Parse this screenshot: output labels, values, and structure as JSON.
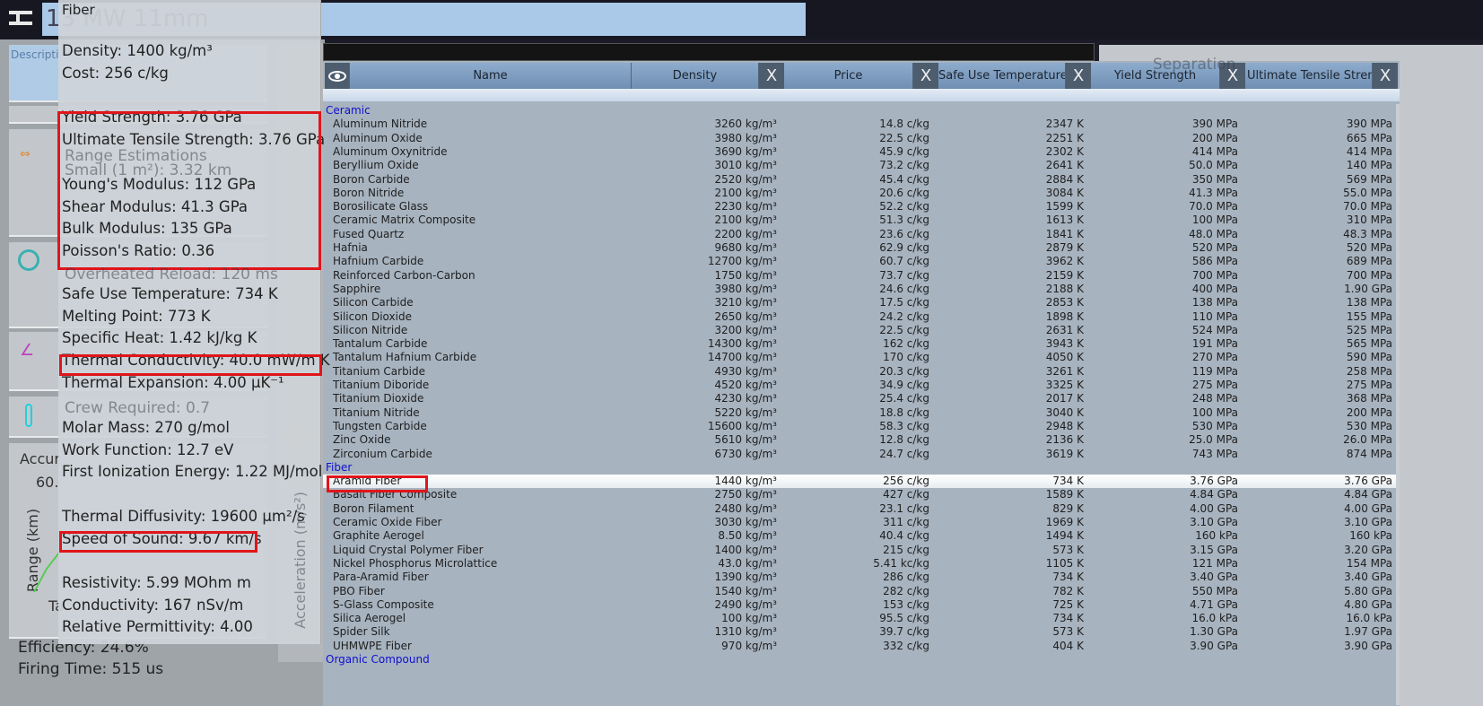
{
  "header": {
    "title": "13 MW 11mm"
  },
  "background": {
    "description_label": "Descripti",
    "range_estimations": "Range Estimations",
    "small_range": "Small (1 m²): 3.32 km",
    "overheated_reload": "Overheated Reload: 120 ms",
    "crew_required": "Crew Required: 0.7",
    "accuracy": "Accur",
    "range_axis": "Range (km)",
    "range_tick": "60.",
    "target_label": "Ta",
    "efficiency": "Efficiency: 24.6%",
    "firing_time": "Firing Time: 515 us",
    "separation": "Separation",
    "acceleration_axis": "Acceleration (m/s²)"
  },
  "tooltip": {
    "title": "Fiber",
    "groups": [
      [
        "Density: 1400 kg/m³",
        "Cost: 256 c/kg"
      ],
      [
        "Yield Strength: 3.76 GPa",
        "Ultimate Tensile Strength: 3.76 GPa"
      ],
      [
        "Young's Modulus: 112 GPa",
        "Shear Modulus: 41.3 GPa",
        "Bulk Modulus: 135 GPa",
        "Poisson's Ratio: 0.36"
      ],
      [
        "Safe Use Temperature: 734 K",
        "Melting Point: 773 K",
        "Specific Heat: 1.42 kJ/kg K",
        "Thermal Conductivity: 40.0 mW/m K",
        "Thermal Expansion: 4.00 µK⁻¹"
      ],
      [
        "Molar Mass: 270 g/mol",
        "Work Function: 12.7 eV",
        "First Ionization Energy: 1.22 MJ/mol"
      ],
      [
        "Thermal Diffusivity: 19600 µm²/s",
        "Speed of Sound: 9.67 km/s"
      ],
      [
        "Resistivity: 5.99 MOhm m",
        "Conductivity: 167 nSv/m",
        "Relative Permittivity: 4.00"
      ]
    ]
  },
  "table": {
    "columns": [
      "Name",
      "Density",
      "Price",
      "Safe Use Temperature",
      "Yield Strength",
      "Ultimate Tensile Strength"
    ],
    "close_label": "X",
    "selected": "Aramid Fiber",
    "categories": [
      {
        "name": "Ceramic",
        "rows": [
          [
            "Aluminum Nitride",
            "3260 kg/m³",
            "14.8 c/kg",
            "2347 K",
            "390 MPa",
            "390 MPa"
          ],
          [
            "Aluminum Oxide",
            "3980 kg/m³",
            "22.5 c/kg",
            "2251 K",
            "200 MPa",
            "665 MPa"
          ],
          [
            "Aluminum Oxynitride",
            "3690 kg/m³",
            "45.9 c/kg",
            "2302 K",
            "414 MPa",
            "414 MPa"
          ],
          [
            "Beryllium Oxide",
            "3010 kg/m³",
            "73.2 c/kg",
            "2641 K",
            "50.0 MPa",
            "140 MPa"
          ],
          [
            "Boron Carbide",
            "2520 kg/m³",
            "45.4 c/kg",
            "2884 K",
            "350 MPa",
            "569 MPa"
          ],
          [
            "Boron Nitride",
            "2100 kg/m³",
            "20.6 c/kg",
            "3084 K",
            "41.3 MPa",
            "55.0 MPa"
          ],
          [
            "Borosilicate Glass",
            "2230 kg/m³",
            "52.2 c/kg",
            "1599 K",
            "70.0 MPa",
            "70.0 MPa"
          ],
          [
            "Ceramic Matrix Composite",
            "2100 kg/m³",
            "51.3 c/kg",
            "1613 K",
            "100 MPa",
            "310 MPa"
          ],
          [
            "Fused Quartz",
            "2200 kg/m³",
            "23.6 c/kg",
            "1841 K",
            "48.0 MPa",
            "48.3 MPa"
          ],
          [
            "Hafnia",
            "9680 kg/m³",
            "62.9 c/kg",
            "2879 K",
            "520 MPa",
            "520 MPa"
          ],
          [
            "Hafnium Carbide",
            "12700 kg/m³",
            "60.7 c/kg",
            "3962 K",
            "586 MPa",
            "689 MPa"
          ],
          [
            "Reinforced Carbon-Carbon",
            "1750 kg/m³",
            "73.7 c/kg",
            "2159 K",
            "700 MPa",
            "700 MPa"
          ],
          [
            "Sapphire",
            "3980 kg/m³",
            "24.6 c/kg",
            "2188 K",
            "400 MPa",
            "1.90 GPa"
          ],
          [
            "Silicon Carbide",
            "3210 kg/m³",
            "17.5 c/kg",
            "2853 K",
            "138 MPa",
            "138 MPa"
          ],
          [
            "Silicon Dioxide",
            "2650 kg/m³",
            "24.2 c/kg",
            "1898 K",
            "110 MPa",
            "155 MPa"
          ],
          [
            "Silicon Nitride",
            "3200 kg/m³",
            "22.5 c/kg",
            "2631 K",
            "524 MPa",
            "525 MPa"
          ],
          [
            "Tantalum Carbide",
            "14300 kg/m³",
            "162 c/kg",
            "3943 K",
            "191 MPa",
            "565 MPa"
          ],
          [
            "Tantalum Hafnium Carbide",
            "14700 kg/m³",
            "170 c/kg",
            "4050 K",
            "270 MPa",
            "590 MPa"
          ],
          [
            "Titanium Carbide",
            "4930 kg/m³",
            "20.3 c/kg",
            "3261 K",
            "119 MPa",
            "258 MPa"
          ],
          [
            "Titanium Diboride",
            "4520 kg/m³",
            "34.9 c/kg",
            "3325 K",
            "275 MPa",
            "275 MPa"
          ],
          [
            "Titanium Dioxide",
            "4230 kg/m³",
            "25.4 c/kg",
            "2017 K",
            "248 MPa",
            "368 MPa"
          ],
          [
            "Titanium Nitride",
            "5220 kg/m³",
            "18.8 c/kg",
            "3040 K",
            "100 MPa",
            "200 MPa"
          ],
          [
            "Tungsten Carbide",
            "15600 kg/m³",
            "58.3 c/kg",
            "2948 K",
            "530 MPa",
            "530 MPa"
          ],
          [
            "Zinc Oxide",
            "5610 kg/m³",
            "12.8 c/kg",
            "2136 K",
            "25.0 MPa",
            "26.0 MPa"
          ],
          [
            "Zirconium Carbide",
            "6730 kg/m³",
            "24.7 c/kg",
            "3619 K",
            "743 MPa",
            "874 MPa"
          ]
        ]
      },
      {
        "name": "Fiber",
        "rows": [
          [
            "Aramid Fiber",
            "1440 kg/m³",
            "256 c/kg",
            "734 K",
            "3.76 GPa",
            "3.76 GPa"
          ],
          [
            "Basalt Fiber Composite",
            "2750 kg/m³",
            "427 c/kg",
            "1589 K",
            "4.84 GPa",
            "4.84 GPa"
          ],
          [
            "Boron Filament",
            "2480 kg/m³",
            "23.1 c/kg",
            "829 K",
            "4.00 GPa",
            "4.00 GPa"
          ],
          [
            "Ceramic Oxide Fiber",
            "3030 kg/m³",
            "311 c/kg",
            "1969 K",
            "3.10 GPa",
            "3.10 GPa"
          ],
          [
            "Graphite Aerogel",
            "8.50 kg/m³",
            "40.4 c/kg",
            "1494 K",
            "160 kPa",
            "160 kPa"
          ],
          [
            "Liquid Crystal Polymer Fiber",
            "1400 kg/m³",
            "215 c/kg",
            "573 K",
            "3.15 GPa",
            "3.20 GPa"
          ],
          [
            "Nickel Phosphorus Microlattice",
            "43.0 kg/m³",
            "5.41 kc/kg",
            "1105 K",
            "121 MPa",
            "154 MPa"
          ],
          [
            "Para-Aramid Fiber",
            "1390 kg/m³",
            "286 c/kg",
            "734 K",
            "3.40 GPa",
            "3.40 GPa"
          ],
          [
            "PBO Fiber",
            "1540 kg/m³",
            "282 c/kg",
            "782 K",
            "550 MPa",
            "5.80 GPa"
          ],
          [
            "S-Glass Composite",
            "2490 kg/m³",
            "153 c/kg",
            "725 K",
            "4.71 GPa",
            "4.80 GPa"
          ],
          [
            "Silica Aerogel",
            "100 kg/m³",
            "95.5 c/kg",
            "734 K",
            "16.0 kPa",
            "16.0 kPa"
          ],
          [
            "Spider Silk",
            "1310 kg/m³",
            "39.7 c/kg",
            "573 K",
            "1.30 GPa",
            "1.97 GPa"
          ],
          [
            "UHMWPE Fiber",
            "970 kg/m³",
            "332 c/kg",
            "404 K",
            "3.90 GPa",
            "3.90 GPa"
          ]
        ]
      },
      {
        "name": "Organic Compound",
        "rows": []
      }
    ]
  },
  "colors": {
    "highlight": "#e0151b",
    "category": "#1010d0",
    "header": "#7f9ec0"
  }
}
